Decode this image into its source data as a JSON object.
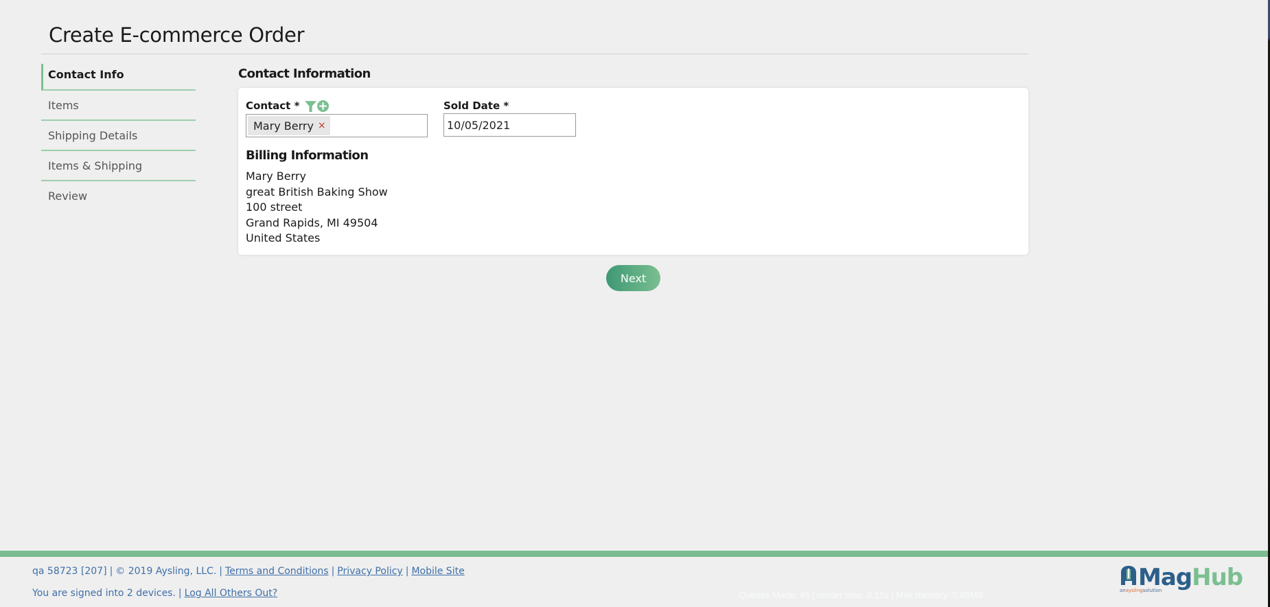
{
  "page": {
    "title": "Create E-commerce Order"
  },
  "sidebar": {
    "items": [
      {
        "label": "Contact Info",
        "active": true
      },
      {
        "label": "Items",
        "active": false
      },
      {
        "label": "Shipping Details",
        "active": false
      },
      {
        "label": "Items & Shipping",
        "active": false
      },
      {
        "label": "Review",
        "active": false
      }
    ]
  },
  "contact_section": {
    "title": "Contact Information",
    "contact_label": "Contact *",
    "contact_icons": [
      "filter-icon",
      "add-circle-icon"
    ],
    "contact_value": "Mary Berry",
    "contact_remove": "×",
    "sold_date_label": "Sold Date *",
    "sold_date_value": "10/05/2021"
  },
  "billing": {
    "title": "Billing Information",
    "lines": [
      "Mary Berry",
      "great British Baking Show",
      "100 street",
      "Grand Rapids, MI 49504",
      "United States"
    ]
  },
  "actions": {
    "next_label": "Next"
  },
  "footer": {
    "build": "qa 58723 [207]",
    "copyright": "© 2019 Aysling, LLC.",
    "links": [
      "Terms and Conditions",
      "Privacy Policy",
      "Mobile Site"
    ],
    "separator": "|",
    "signed_in": "You are signed into 2 devices.",
    "logout_link": "Log All Others Out?",
    "debug": "Queries Made: 46 | render time: 0.15s | Max memory: 5.65MB"
  },
  "logo": {
    "mag": "Mag",
    "hub": "Hub",
    "tag_prefix": "an",
    "tag_brand": "aysling",
    "tag_suffix": "solution"
  },
  "colors": {
    "accent_green": "#7bbf91",
    "button_green_start": "#3e9873",
    "link_blue": "#3f6fa8",
    "logo_blue": "#2c5f8a",
    "remove_red": "#c0392b",
    "logo_orange": "#e26a2c"
  }
}
